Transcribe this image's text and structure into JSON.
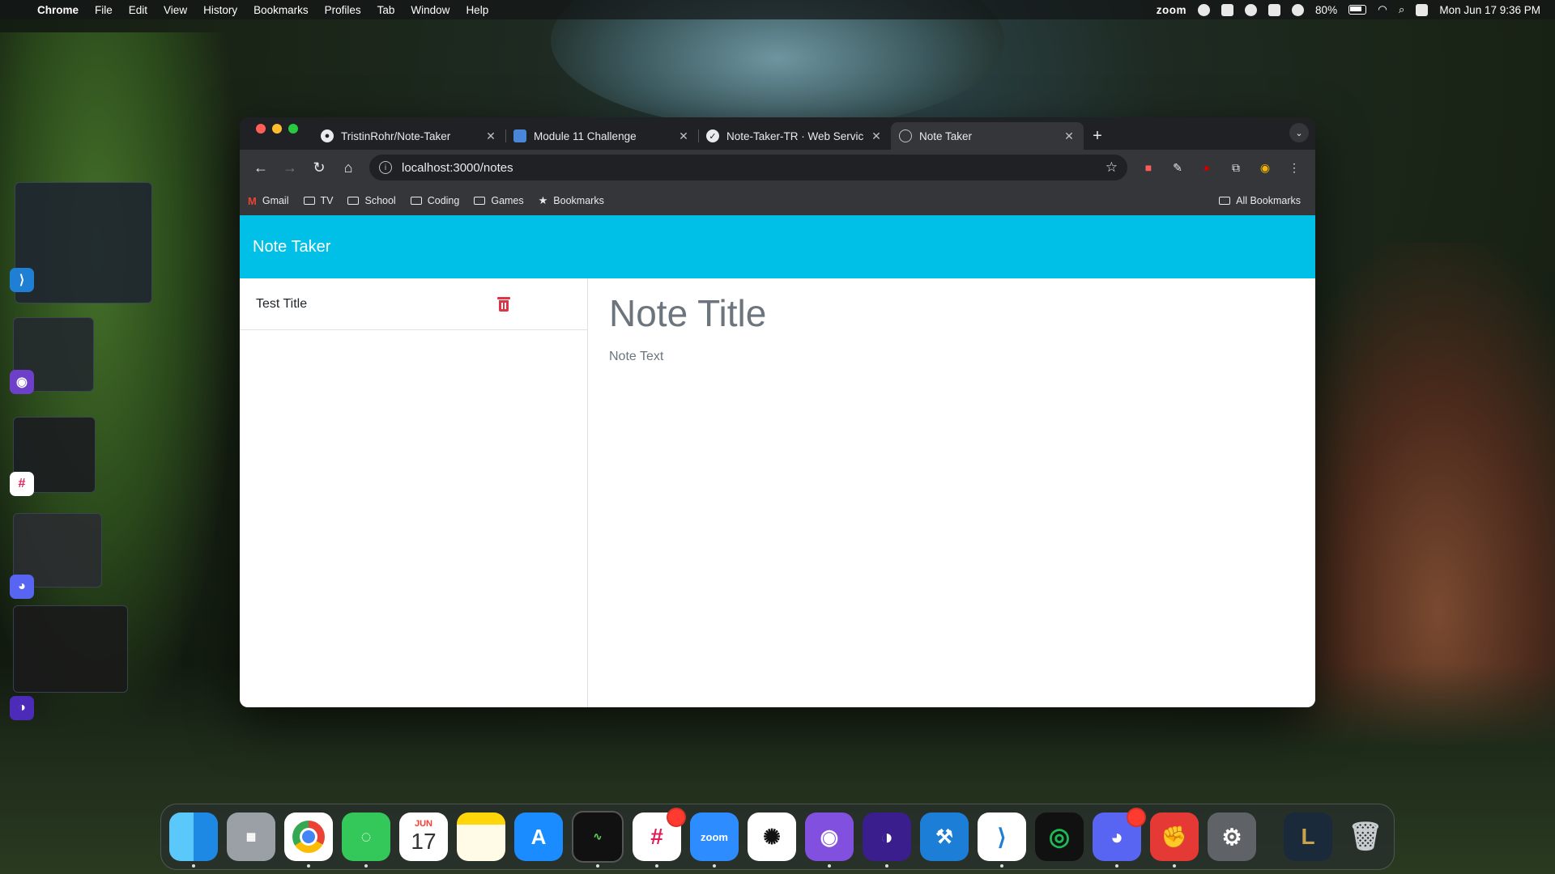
{
  "menubar": {
    "app": "Chrome",
    "menus": [
      "File",
      "Edit",
      "View",
      "History",
      "Bookmarks",
      "Profiles",
      "Tab",
      "Window",
      "Help"
    ],
    "zoom_label": "zoom",
    "battery": "80%",
    "clock": "Mon Jun 17  9:36 PM"
  },
  "browser": {
    "tabs": [
      {
        "label": "TristinRohr/Note-Taker",
        "icon": "github-icon"
      },
      {
        "label": "Module 11 Challenge",
        "icon": "doc-icon"
      },
      {
        "label": "Note-Taker-TR · Web Servic",
        "icon": "render-icon"
      },
      {
        "label": "Note Taker",
        "icon": "globe-icon"
      }
    ],
    "active_tab": 3,
    "url": "localhost:3000/notes",
    "bookmarks": [
      "Gmail",
      "TV",
      "School",
      "Coding",
      "Games",
      "Bookmarks"
    ],
    "all_bookmarks": "All Bookmarks"
  },
  "page": {
    "brand": "Note Taker",
    "notes": [
      {
        "title": "Test Title"
      }
    ],
    "title_placeholder": "Note Title",
    "text_placeholder": "Note Text"
  },
  "dock": {
    "calendar_month": "JUN",
    "calendar_day": "17",
    "zoom_label": "zoom"
  },
  "colors": {
    "navbar": "#00c0e8",
    "delete_icon": "#dc3545"
  }
}
